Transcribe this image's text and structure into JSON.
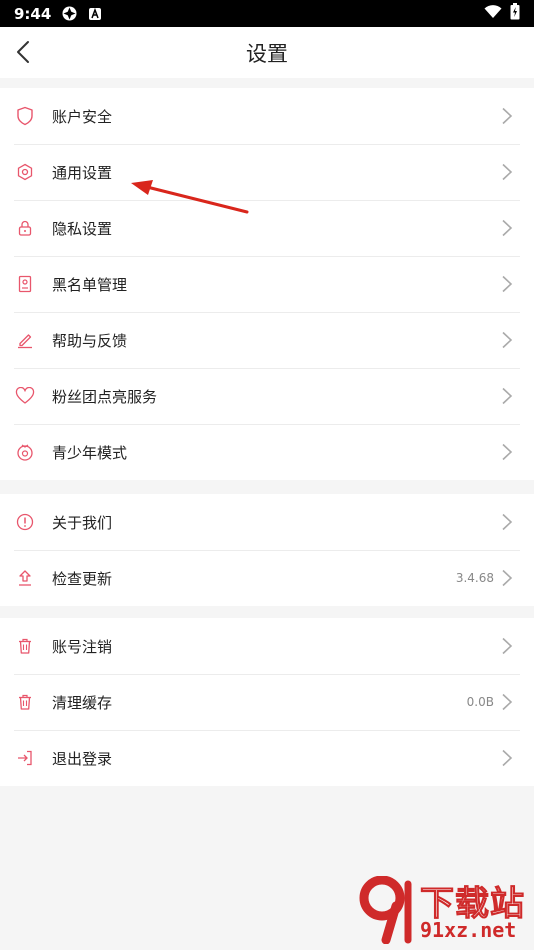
{
  "status_bar": {
    "time": "9:44"
  },
  "header": {
    "title": "设置"
  },
  "colors": {
    "accent": "#e8566c",
    "chevron": "#aaaaaa",
    "annotation_arrow": "#d9261c"
  },
  "sections": [
    {
      "items": [
        {
          "label": "账户安全",
          "icon": "shield-icon"
        },
        {
          "label": "通用设置",
          "icon": "hexagon-gear-icon"
        },
        {
          "label": "隐私设置",
          "icon": "lock-icon"
        },
        {
          "label": "黑名单管理",
          "icon": "book-icon"
        },
        {
          "label": "帮助与反馈",
          "icon": "pencil-icon"
        },
        {
          "label": "粉丝团点亮服务",
          "icon": "heart-icon"
        },
        {
          "label": "青少年模式",
          "icon": "youth-mode-icon"
        }
      ]
    },
    {
      "items": [
        {
          "label": "关于我们",
          "icon": "info-icon"
        },
        {
          "label": "检查更新",
          "icon": "upload-icon",
          "value": "3.4.68"
        }
      ]
    },
    {
      "items": [
        {
          "label": "账号注销",
          "icon": "trash-icon"
        },
        {
          "label": "清理缓存",
          "icon": "trash-icon",
          "value": "0.0B"
        },
        {
          "label": "退出登录",
          "icon": "logout-icon"
        }
      ]
    }
  ],
  "watermark": {
    "brand_cn": "下载站",
    "brand_en": "91xz.net"
  }
}
